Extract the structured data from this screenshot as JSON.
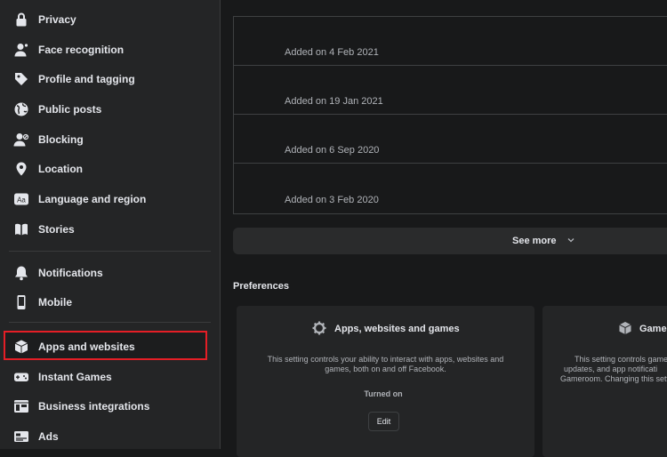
{
  "sidebar": {
    "items": [
      {
        "label": "Privacy",
        "icon": "lock-icon"
      },
      {
        "label": "Face recognition",
        "icon": "face-recognition-icon"
      },
      {
        "label": "Profile and tagging",
        "icon": "tag-icon"
      },
      {
        "label": "Public posts",
        "icon": "globe-icon"
      },
      {
        "label": "Blocking",
        "icon": "block-user-icon"
      },
      {
        "label": "Location",
        "icon": "location-pin-icon"
      },
      {
        "label": "Language and region",
        "icon": "language-icon"
      },
      {
        "label": "Stories",
        "icon": "book-icon"
      },
      {
        "label": "Notifications",
        "icon": "bell-icon"
      },
      {
        "label": "Mobile",
        "icon": "mobile-icon"
      },
      {
        "label": "Apps and websites",
        "icon": "cube-icon",
        "selected": true
      },
      {
        "label": "Instant Games",
        "icon": "gamepad-icon"
      },
      {
        "label": "Business integrations",
        "icon": "business-integrations-icon"
      },
      {
        "label": "Ads",
        "icon": "ads-icon"
      }
    ]
  },
  "apps_list": {
    "rows": [
      {
        "added": "Added on 4 Feb 2021"
      },
      {
        "added": "Added on 19 Jan 2021"
      },
      {
        "added": "Added on 6 Sep 2020"
      },
      {
        "added": "Added on 3 Feb 2020"
      }
    ],
    "see_more": "See more"
  },
  "preferences": {
    "heading": "Preferences",
    "cards": [
      {
        "title": "Apps, websites and games",
        "icon": "gear-icon",
        "desc_lines": [
          "This setting controls your ability to interact with apps, websites and",
          "games, both on and off Facebook."
        ],
        "status": "Turned on",
        "button": "Edit"
      },
      {
        "title": "Game",
        "icon": "cube-icon",
        "desc_lines": [
          "This setting controls game",
          "updates, and app notificati",
          "Gameroom. Changing this sett"
        ]
      }
    ]
  },
  "colors": {
    "highlight_border": "#e41e26",
    "sidebar_bg": "#242526",
    "page_bg": "#18191a"
  }
}
